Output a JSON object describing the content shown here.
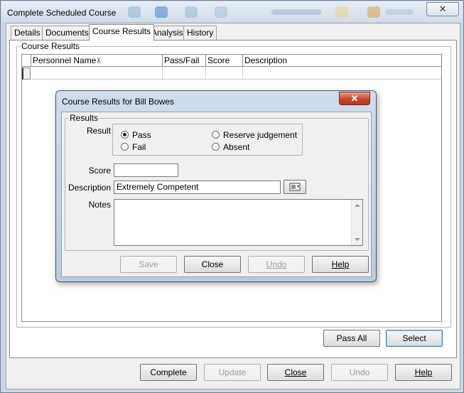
{
  "window": {
    "title": "Complete Scheduled Course",
    "close_glyph": "✕"
  },
  "tabs": [
    {
      "label": "Details",
      "active": false
    },
    {
      "label": "Documents",
      "active": false
    },
    {
      "label": "Course Results",
      "active": true
    },
    {
      "label": "Analysis",
      "active": false
    },
    {
      "label": "History",
      "active": false
    }
  ],
  "course_results": {
    "group_label": "Course Results",
    "columns": [
      "Personnel Name",
      "Pass/Fail",
      "Score",
      "Description"
    ],
    "sort_glyph": "⊼",
    "rows": [
      {
        "name": "",
        "pass_fail": "",
        "score": "",
        "description": ""
      }
    ]
  },
  "panel_buttons": {
    "pass_all": "Pass All",
    "select": "Select"
  },
  "bottom_buttons": {
    "complete": "Complete",
    "update": "Update",
    "close": "Close",
    "undo": "Undo",
    "help": "Help"
  },
  "dialog": {
    "title": "Course Results for Bill Bowes",
    "close_glyph": "✕",
    "results_group": "Results",
    "result_label": "Result",
    "result_options": [
      {
        "label": "Pass",
        "selected": true
      },
      {
        "label": "Fail",
        "selected": false
      },
      {
        "label": "Reserve judgement",
        "selected": false
      },
      {
        "label": "Absent",
        "selected": false
      }
    ],
    "score_label": "Score",
    "score_value": "",
    "description_label": "Description",
    "description_value": "Extremely Competent",
    "lookup_icon": "list-lookup-icon",
    "notes_label": "Notes",
    "notes_value": "",
    "buttons": {
      "save": "Save",
      "close": "Close",
      "undo": "Undo",
      "help": "Help"
    }
  }
}
